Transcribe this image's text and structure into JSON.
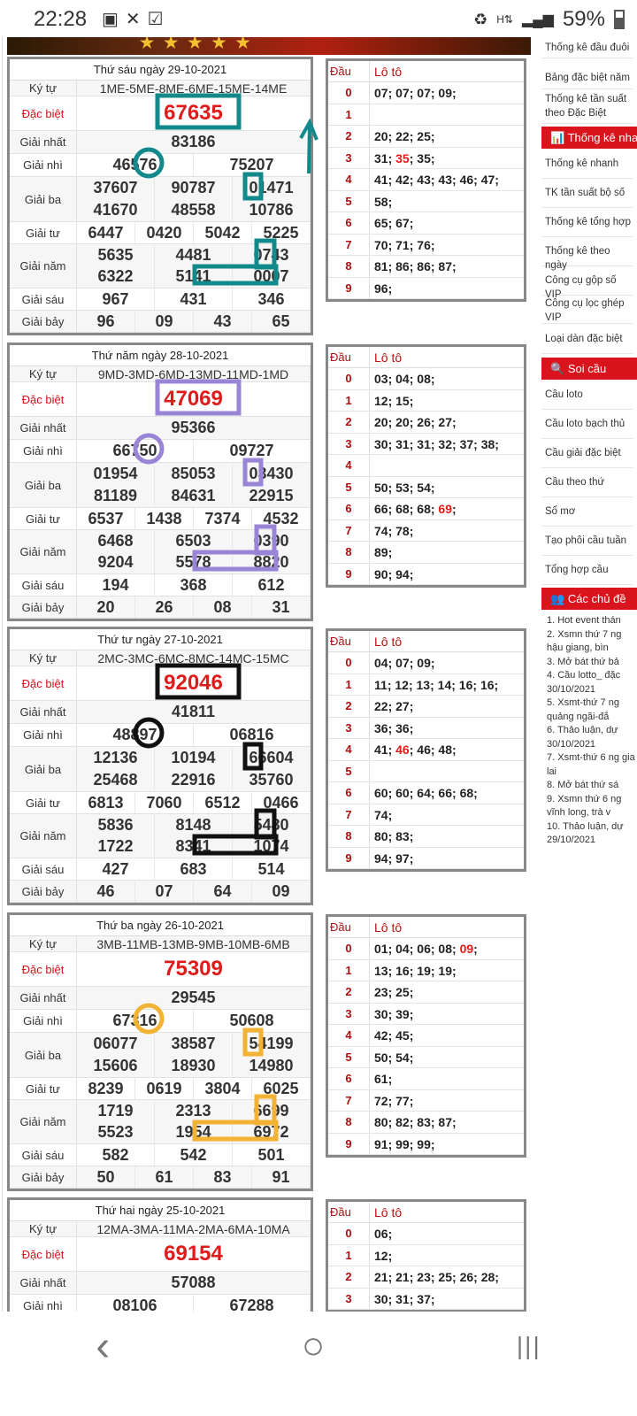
{
  "status_bar": {
    "time": "22:28",
    "battery": "59%",
    "notification_icons": [
      "image-icon",
      "missed-call-icon",
      "check-icon"
    ],
    "right_icons": [
      "recycle-icon",
      "data-hplus-icon",
      "signal-icon",
      "battery-icon"
    ]
  },
  "annotation_colors": [
    "#12898a",
    "#9a84d6",
    "#111111",
    "#f2b233"
  ],
  "results": [
    {
      "title": "Thứ sáu ngày 29-10-2021",
      "ky_tu": "1ME-5ME-8ME-6ME-15ME-14ME",
      "dac_biet": "67635",
      "giai_nhat": "83186",
      "giai_nhi": [
        "46576",
        "75207"
      ],
      "giai_ba": [
        "37607",
        "90787",
        "01471",
        "41670",
        "48558",
        "10786"
      ],
      "giai_tu": [
        "6447",
        "0420",
        "5042",
        "5225"
      ],
      "giai_nam": [
        "5635",
        "4481",
        "0743",
        "6322",
        "5141",
        "0007"
      ],
      "giai_sau": [
        "967",
        "431",
        "346"
      ],
      "giai_bay": [
        "96",
        "09",
        "43",
        "65"
      ],
      "loto": [
        {
          "dau": "0",
          "so": [
            "07",
            "07",
            "07",
            "09"
          ],
          "hl": []
        },
        {
          "dau": "1",
          "so": [],
          "hl": []
        },
        {
          "dau": "2",
          "so": [
            "20",
            "22",
            "25"
          ],
          "hl": []
        },
        {
          "dau": "3",
          "so": [
            "31",
            "35",
            "35"
          ],
          "hl": [
            1
          ]
        },
        {
          "dau": "4",
          "so": [
            "41",
            "42",
            "43",
            "43",
            "46",
            "47"
          ],
          "hl": []
        },
        {
          "dau": "5",
          "so": [
            "58"
          ],
          "hl": []
        },
        {
          "dau": "6",
          "so": [
            "65",
            "67"
          ],
          "hl": []
        },
        {
          "dau": "7",
          "so": [
            "70",
            "71",
            "76"
          ],
          "hl": []
        },
        {
          "dau": "8",
          "so": [
            "81",
            "86",
            "86",
            "87"
          ],
          "hl": []
        },
        {
          "dau": "9",
          "so": [
            "96"
          ],
          "hl": []
        }
      ]
    },
    {
      "title": "Thứ năm ngày 28-10-2021",
      "ky_tu": "9MD-3MD-6MD-13MD-11MD-1MD",
      "dac_biet": "47069",
      "giai_nhat": "95366",
      "giai_nhi": [
        "66750",
        "09727"
      ],
      "giai_ba": [
        "01954",
        "85053",
        "03430",
        "81189",
        "84631",
        "22915"
      ],
      "giai_tu": [
        "6537",
        "1438",
        "7374",
        "4532"
      ],
      "giai_nam": [
        "6468",
        "6503",
        "0390",
        "9204",
        "5578",
        "8820"
      ],
      "giai_sau": [
        "194",
        "368",
        "612"
      ],
      "giai_bay": [
        "20",
        "26",
        "08",
        "31"
      ],
      "loto": [
        {
          "dau": "0",
          "so": [
            "03",
            "04",
            "08"
          ],
          "hl": []
        },
        {
          "dau": "1",
          "so": [
            "12",
            "15"
          ],
          "hl": []
        },
        {
          "dau": "2",
          "so": [
            "20",
            "20",
            "26",
            "27"
          ],
          "hl": []
        },
        {
          "dau": "3",
          "so": [
            "30",
            "31",
            "31",
            "32",
            "37",
            "38"
          ],
          "hl": []
        },
        {
          "dau": "4",
          "so": [],
          "hl": []
        },
        {
          "dau": "5",
          "so": [
            "50",
            "53",
            "54"
          ],
          "hl": []
        },
        {
          "dau": "6",
          "so": [
            "66",
            "68",
            "68",
            "69"
          ],
          "hl": [
            3
          ]
        },
        {
          "dau": "7",
          "so": [
            "74",
            "78"
          ],
          "hl": []
        },
        {
          "dau": "8",
          "so": [
            "89"
          ],
          "hl": []
        },
        {
          "dau": "9",
          "so": [
            "90",
            "94"
          ],
          "hl": []
        }
      ]
    },
    {
      "title": "Thứ tư ngày 27-10-2021",
      "ky_tu": "2MC-3MC-6MC-8MC-14MC-15MC",
      "dac_biet": "92046",
      "giai_nhat": "41811",
      "giai_nhi": [
        "48897",
        "06816"
      ],
      "giai_ba": [
        "12136",
        "10194",
        "66604",
        "25468",
        "22916",
        "35760"
      ],
      "giai_tu": [
        "6813",
        "7060",
        "6512",
        "0466"
      ],
      "giai_nam": [
        "5836",
        "8148",
        "5480",
        "1722",
        "8341",
        "1074"
      ],
      "giai_sau": [
        "427",
        "683",
        "514"
      ],
      "giai_bay": [
        "46",
        "07",
        "64",
        "09"
      ],
      "loto": [
        {
          "dau": "0",
          "so": [
            "04",
            "07",
            "09"
          ],
          "hl": []
        },
        {
          "dau": "1",
          "so": [
            "11",
            "12",
            "13",
            "14",
            "16",
            "16"
          ],
          "hl": []
        },
        {
          "dau": "2",
          "so": [
            "22",
            "27"
          ],
          "hl": []
        },
        {
          "dau": "3",
          "so": [
            "36",
            "36"
          ],
          "hl": []
        },
        {
          "dau": "4",
          "so": [
            "41",
            "46",
            "46",
            "48"
          ],
          "hl": [
            1
          ]
        },
        {
          "dau": "5",
          "so": [],
          "hl": []
        },
        {
          "dau": "6",
          "so": [
            "60",
            "60",
            "64",
            "66",
            "68"
          ],
          "hl": []
        },
        {
          "dau": "7",
          "so": [
            "74"
          ],
          "hl": []
        },
        {
          "dau": "8",
          "so": [
            "80",
            "83"
          ],
          "hl": []
        },
        {
          "dau": "9",
          "so": [
            "94",
            "97"
          ],
          "hl": []
        }
      ]
    },
    {
      "title": "Thứ ba ngày 26-10-2021",
      "ky_tu": "3MB-11MB-13MB-9MB-10MB-6MB",
      "dac_biet": "75309",
      "giai_nhat": "29545",
      "giai_nhi": [
        "67316",
        "50608"
      ],
      "giai_ba": [
        "06077",
        "38587",
        "54199",
        "15606",
        "18930",
        "14980"
      ],
      "giai_tu": [
        "8239",
        "0619",
        "3804",
        "6025"
      ],
      "giai_nam": [
        "1719",
        "2313",
        "6699",
        "5523",
        "1954",
        "6972"
      ],
      "giai_sau": [
        "582",
        "542",
        "501"
      ],
      "giai_bay": [
        "50",
        "61",
        "83",
        "91"
      ],
      "loto": [
        {
          "dau": "0",
          "so": [
            "01",
            "04",
            "06",
            "08",
            "09"
          ],
          "hl": [
            4
          ]
        },
        {
          "dau": "1",
          "so": [
            "13",
            "16",
            "19",
            "19"
          ],
          "hl": []
        },
        {
          "dau": "2",
          "so": [
            "23",
            "25"
          ],
          "hl": []
        },
        {
          "dau": "3",
          "so": [
            "30",
            "39"
          ],
          "hl": []
        },
        {
          "dau": "4",
          "so": [
            "42",
            "45"
          ],
          "hl": []
        },
        {
          "dau": "5",
          "so": [
            "50",
            "54"
          ],
          "hl": []
        },
        {
          "dau": "6",
          "so": [
            "61"
          ],
          "hl": []
        },
        {
          "dau": "7",
          "so": [
            "72",
            "77"
          ],
          "hl": []
        },
        {
          "dau": "8",
          "so": [
            "80",
            "82",
            "83",
            "87"
          ],
          "hl": []
        },
        {
          "dau": "9",
          "so": [
            "91",
            "99",
            "99"
          ],
          "hl": []
        }
      ]
    },
    {
      "title": "Thứ hai ngày 25-10-2021",
      "ky_tu": "12MA-3MA-11MA-2MA-6MA-10MA",
      "dac_biet": "69154",
      "giai_nhat": "57088",
      "giai_nhi": [
        "08106",
        "67288"
      ],
      "loto": [
        {
          "dau": "0",
          "so": [
            "06"
          ],
          "hl": []
        },
        {
          "dau": "1",
          "so": [
            "12"
          ],
          "hl": []
        },
        {
          "dau": "2",
          "so": [
            "21",
            "21",
            "23",
            "25",
            "26",
            "28"
          ],
          "hl": []
        },
        {
          "dau": "3",
          "so": [
            "30",
            "31",
            "37"
          ],
          "hl": []
        }
      ]
    }
  ],
  "labels": {
    "ky_tu": "Ký tự",
    "dac_biet": "Đặc biệt",
    "giai_nhat": "Giải nhất",
    "giai_nhi": "Giải nhì",
    "giai_ba": "Giải ba",
    "giai_tu": "Giải tư",
    "giai_nam": "Giải năm",
    "giai_sau": "Giải sáu",
    "giai_bay": "Giải bảy",
    "dau": "Đầu",
    "loto": "Lô tô"
  },
  "sidebar": {
    "top_items": [
      "Thống kê đầu đuôi",
      "Bảng đặc biệt năm",
      "Thống kê tần suất theo Đặc Biệt"
    ],
    "thong_ke": {
      "title": "Thống kê nhanh",
      "items": [
        "Thống kê nhanh",
        "TK tần suất bộ số",
        "Thống kê tổng hợp",
        "Thống kê theo ngày",
        "Công cụ gộp số VIP",
        "Công cụ lọc ghép VIP",
        "Loại dàn đặc biệt"
      ]
    },
    "soi_cau": {
      "title": "Soi cầu",
      "items": [
        "Cầu loto",
        "Cầu loto bạch thủ",
        "Cầu giải đặc biệt",
        "Cầu theo thứ",
        "Sổ mơ",
        "Tạo phôi cầu tuần",
        "Tổng hợp cầu"
      ]
    },
    "chu_de": {
      "title": "Các chủ đề",
      "items": [
        "1. Hot event thán",
        "2. Xsmn thứ 7 ng hậu giang, bìn",
        "3. Mở bát thứ bả",
        "4. Cầu lotto_ đặc 30/10/2021",
        "5. Xsmt-thứ 7 ng quảng ngãi-đắ",
        "6. Thảo luận, dự 30/10/2021",
        "7. Xsmt-thứ 6 ng gia lai",
        "8. Mở bát thứ sá",
        "9. Xsmn thứ 6 ng vĩnh long, trà v",
        "10. Thảo luận, dự 29/10/2021"
      ]
    }
  },
  "nav": {
    "back": "‹",
    "home": "○",
    "recents": "|||"
  }
}
